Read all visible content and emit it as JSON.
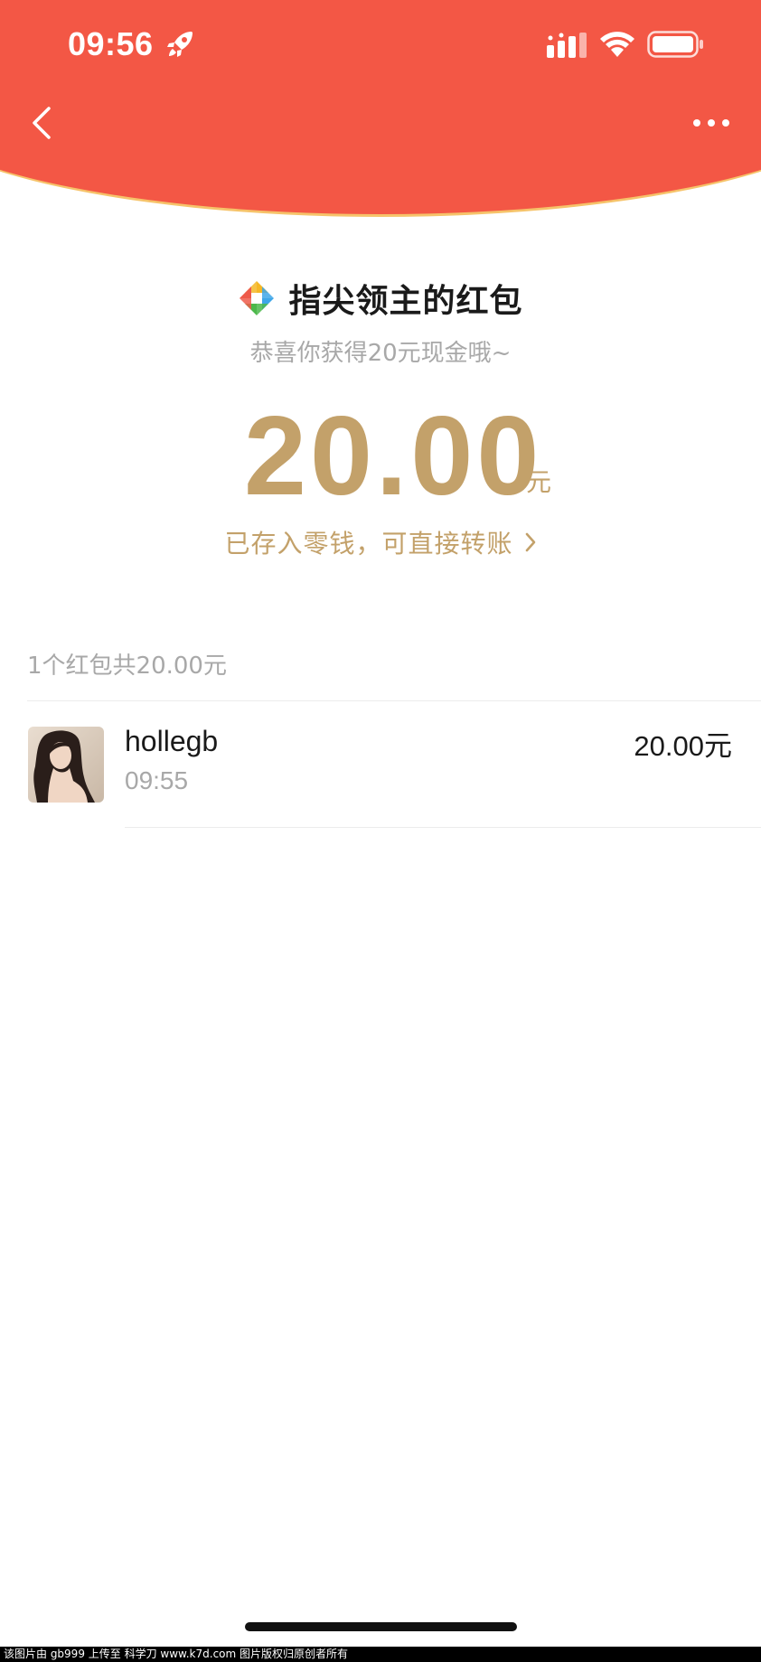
{
  "status_bar": {
    "time": "09:56",
    "icons": [
      "rocket-icon",
      "signal-icon",
      "wifi-icon",
      "battery-icon"
    ]
  },
  "nav": {
    "back_icon": "chevron-left-icon",
    "more_icon": "more-dots-icon"
  },
  "red_packet": {
    "title": "指尖领主的红包",
    "subtitle": "恭喜你获得20元现金哦~",
    "amount": "20.00",
    "unit": "元",
    "deposit_link": "已存入零钱，可直接转账"
  },
  "summary": "1个红包共20.00元",
  "records": [
    {
      "name": "hollegb",
      "time": "09:55",
      "amount": "20.00元"
    }
  ],
  "watermark": "该图片由 gb999 上传至 科学刀 www.k7d.com 图片版权归原创者所有",
  "colors": {
    "header_red": "#f35745",
    "header_edge": "#f6c36a",
    "gold": "#c3a16a",
    "gray_text": "#a8a8a8",
    "dark_text": "#1a1a1a"
  }
}
